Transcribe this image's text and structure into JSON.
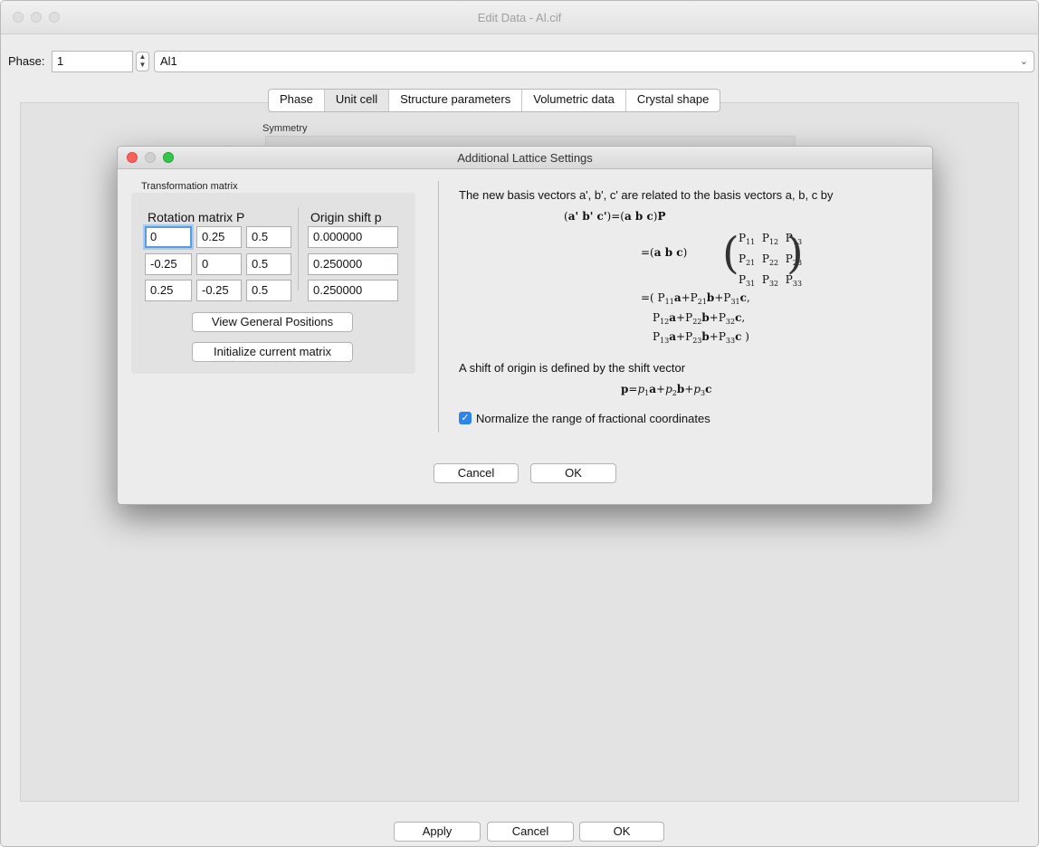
{
  "window": {
    "title": "Edit Data - Al.cif"
  },
  "phase": {
    "label": "Phase:",
    "number": "1",
    "name": "Al1"
  },
  "tabs": [
    "Phase",
    "Unit cell",
    "Structure parameters",
    "Volumetric data",
    "Crystal shape"
  ],
  "active_tab": "Unit cell",
  "symmetry_label": "Symmetry",
  "dialog": {
    "title": "Additional Lattice Settings",
    "group_label": "Transformation matrix",
    "rotation_header": "Rotation matrix P",
    "origin_header": "Origin shift p",
    "rotation": [
      [
        "0",
        "0.25",
        "0.5"
      ],
      [
        "-0.25",
        "0",
        "0.5"
      ],
      [
        "0.25",
        "-0.25",
        "0.5"
      ]
    ],
    "origin": [
      "0.000000",
      "0.250000",
      "0.250000"
    ],
    "view_general_positions": "View General Positions",
    "initialize_matrix": "Initialize current matrix",
    "description": "The new basis vectors a', b', c' are related to the basis vectors a, b, c by",
    "shift_text": "A shift of origin is defined by the shift vector",
    "normalize_label": "Normalize the range of fractional coordinates",
    "normalize_checked": true,
    "cancel": "Cancel",
    "ok": "OK"
  },
  "footer": {
    "apply": "Apply",
    "cancel": "Cancel",
    "ok": "OK"
  },
  "colors": {
    "close": "#fc605c",
    "minimize": "#c8c8c8",
    "zoom": "#34c84a",
    "accent": "#2f84ea"
  }
}
